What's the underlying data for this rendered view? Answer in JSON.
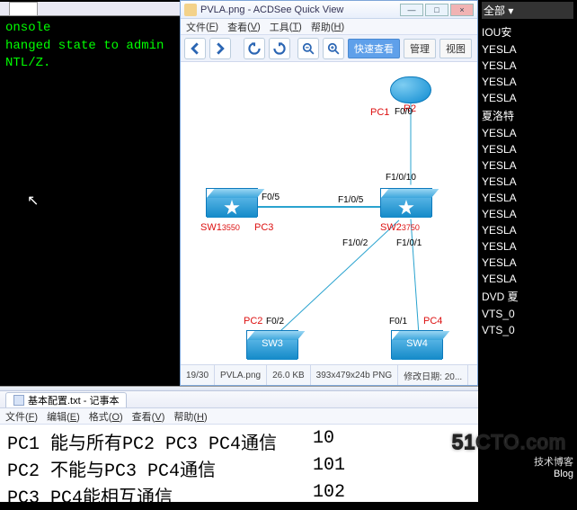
{
  "terminal": {
    "lines": [
      "",
      "",
      "",
      "",
      "onsole",
      "",
      "",
      "",
      "",
      "",
      "",
      "",
      "",
      "",
      "",
      "hanged state to admin",
      "",
      "NTL/Z."
    ],
    "cursor": "↖"
  },
  "viewer": {
    "title": "PVLA.png - ACDSee Quick View",
    "winbtn_min": "—",
    "winbtn_max": "□",
    "winbtn_close": "×",
    "menu": {
      "file": "文件",
      "file_k": "F",
      "view": "查看",
      "view_k": "V",
      "tools": "工具",
      "tools_k": "T",
      "help": "帮助",
      "help_k": "H"
    },
    "toolbar": {
      "quick": "快速查看",
      "manage": "管理",
      "viewbtn": "视图"
    },
    "status": {
      "idx": "19/30",
      "file": "PVLA.png",
      "size": "26.0 KB",
      "dim": "393x479x24b PNG",
      "mod": "修改日期: 20..."
    }
  },
  "diagram": {
    "R2": "R2",
    "PC1": "PC1",
    "F00": "F0/0",
    "F1010": "F1/0/10",
    "SW1": "SW1",
    "SW1ext": "3550",
    "PC3": "PC3",
    "F05": "F0/5",
    "F105": "F1/0/5",
    "SW2": "SW2",
    "SW2ext": "3750",
    "F102": "F1/0/2",
    "F101": "F1/0/1",
    "PC2": "PC2",
    "F02": "F0/2",
    "SW3": "SW3",
    "F01": "F0/1",
    "PC4": "PC4",
    "SW4": "SW4"
  },
  "notepad": {
    "tab": "基本配置.txt - 记事本",
    "menu": {
      "file": "文件",
      "file_k": "F",
      "edit": "编辑",
      "edit_k": "E",
      "format": "格式",
      "format_k": "O",
      "view": "查看",
      "view_k": "V",
      "help": "帮助",
      "help_k": "H"
    },
    "rows": [
      {
        "a": "PC1 能与所有PC2 PC3 PC4通信",
        "b": "10"
      },
      {
        "a": "PC2 不能与PC3 PC4通信",
        "b": "101"
      },
      {
        "a": "PC3  PC4能相互通信",
        "b": "102"
      }
    ]
  },
  "sidebar": {
    "header": "全部 ▾",
    "items": [
      "IOU安",
      "YESLA",
      "YESLA",
      "YESLA",
      "YESLA",
      "夏洛特",
      "YESLA",
      "YESLA",
      "YESLA",
      "YESLA",
      "YESLA",
      "YESLA",
      "YESLA",
      "YESLA",
      "YESLA",
      "YESLA",
      "DVD 夏",
      "VTS_0",
      "VTS_0"
    ]
  },
  "watermark": {
    "big": "51CTO.com",
    "sm1": "技术博客",
    "sm2": "Blog"
  }
}
